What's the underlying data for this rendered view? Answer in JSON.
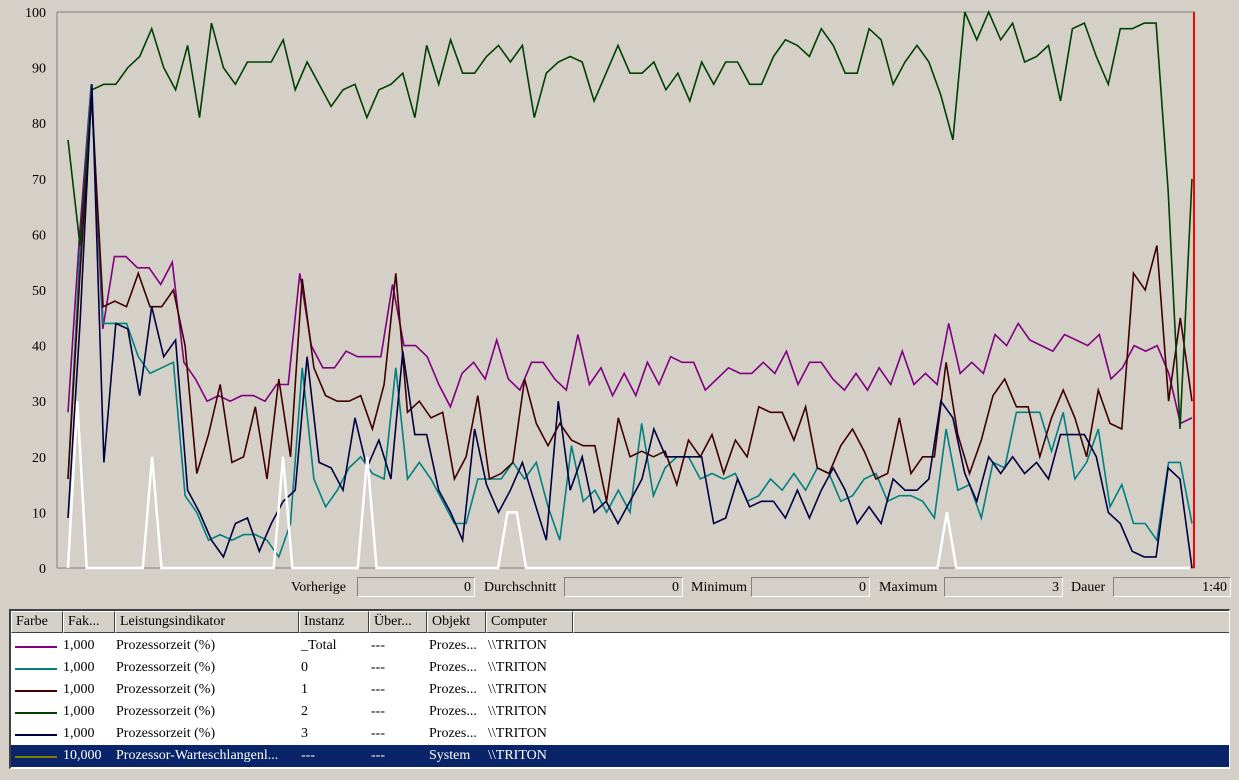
{
  "graph": {
    "ylim": [
      0,
      100
    ],
    "y_ticks": [
      "100",
      "90",
      "80",
      "70",
      "60",
      "50",
      "40",
      "30",
      "20",
      "10",
      "0"
    ],
    "cursor_color": "#ff0000",
    "background": "#d4d0c8",
    "series": [
      {
        "name": "Prozessorzeit (%) _Total",
        "color": "#800080",
        "values": [
          28,
          60,
          87,
          43,
          56,
          56,
          54,
          54,
          51,
          55,
          37,
          34,
          30,
          31,
          30,
          31,
          31,
          30,
          33,
          33,
          53,
          40,
          36,
          36,
          39,
          38,
          38,
          38,
          51,
          40,
          40,
          38,
          33,
          29,
          35,
          37,
          34,
          41,
          34,
          32,
          37,
          37,
          34,
          32,
          42,
          33,
          36,
          31,
          35,
          31,
          37,
          33,
          38,
          37,
          37,
          32,
          34,
          36,
          35,
          35,
          37,
          35,
          39,
          33,
          37,
          37,
          34,
          32,
          35,
          32,
          36,
          33,
          39,
          33,
          35,
          33,
          44,
          35,
          37,
          35,
          42,
          40,
          44,
          41,
          40,
          39,
          42,
          41,
          40,
          42,
          34,
          36,
          40,
          39,
          40,
          35,
          26,
          27
        ]
      },
      {
        "name": "Prozessorzeit (%) 0",
        "color": "#008080",
        "values": [
          16,
          56,
          87,
          44,
          44,
          44,
          38,
          35,
          36,
          37,
          13,
          10,
          5,
          6,
          5,
          6,
          6,
          5,
          2,
          8,
          36,
          16,
          11,
          14,
          18,
          20,
          17,
          16,
          36,
          16,
          19,
          16,
          12,
          8,
          8,
          16,
          16,
          16,
          19,
          16,
          19,
          11,
          5,
          22,
          12,
          14,
          10,
          14,
          10,
          26,
          13,
          18,
          20,
          20,
          16,
          17,
          16,
          17,
          12,
          13,
          16,
          14,
          17,
          14,
          18,
          17,
          12,
          13,
          16,
          17,
          12,
          13,
          13,
          12,
          9,
          25,
          14,
          15,
          9,
          19,
          18,
          28,
          28,
          28,
          21,
          28,
          16,
          19,
          25,
          11,
          15,
          8,
          8,
          5,
          19,
          19,
          8
        ]
      },
      {
        "name": "Prozessorzeit (%) 1",
        "color": "#400000",
        "values": [
          16,
          52,
          85,
          47,
          48,
          47,
          53,
          47,
          47,
          50,
          40,
          17,
          24,
          33,
          19,
          20,
          29,
          16,
          34,
          20,
          52,
          36,
          31,
          30,
          30,
          31,
          25,
          33,
          53,
          28,
          30,
          27,
          28,
          16,
          20,
          31,
          16,
          17,
          19,
          34,
          26,
          22,
          26,
          23,
          22,
          22,
          12,
          27,
          20,
          21,
          20,
          21,
          15,
          23,
          20,
          24,
          17,
          23,
          20,
          29,
          28,
          28,
          23,
          29,
          18,
          17,
          22,
          25,
          21,
          16,
          17,
          27,
          17,
          20,
          20,
          37,
          24,
          17,
          23,
          31,
          34,
          29,
          29,
          20,
          27,
          32,
          27,
          20,
          32,
          26,
          25,
          53,
          50,
          58,
          30,
          45,
          30
        ]
      },
      {
        "name": "Prozessorzeit (%) 2",
        "color": "#004000",
        "values": [
          77,
          58,
          86,
          87,
          87,
          90,
          92,
          97,
          90,
          86,
          94,
          81,
          98,
          90,
          87,
          91,
          91,
          91,
          95,
          86,
          91,
          87,
          83,
          86,
          87,
          81,
          86,
          87,
          89,
          81,
          94,
          87,
          95,
          89,
          89,
          92,
          94,
          91,
          94,
          81,
          89,
          91,
          92,
          91,
          84,
          89,
          94,
          89,
          89,
          91,
          86,
          89,
          84,
          91,
          87,
          91,
          91,
          87,
          87,
          92,
          95,
          94,
          92,
          97,
          94,
          89,
          89,
          97,
          95,
          87,
          91,
          94,
          91,
          85,
          77,
          100,
          95,
          100,
          95,
          98,
          91,
          92,
          94,
          84,
          97,
          98,
          92,
          87,
          97,
          97,
          98,
          98,
          68,
          25,
          70
        ]
      },
      {
        "name": "Prozessorzeit (%) 3",
        "color": "#000040",
        "values": [
          9,
          44,
          87,
          19,
          44,
          43,
          31,
          47,
          38,
          41,
          14,
          10,
          5,
          2,
          8,
          9,
          3,
          8,
          12,
          14,
          38,
          19,
          18,
          14,
          27,
          18,
          23,
          16,
          39,
          24,
          24,
          14,
          10,
          5,
          25,
          15,
          10,
          14,
          19,
          12,
          5,
          30,
          14,
          20,
          10,
          12,
          8,
          12,
          16,
          25,
          20,
          20,
          20,
          20,
          8,
          9,
          16,
          11,
          12,
          12,
          9,
          14,
          9,
          14,
          18,
          14,
          8,
          11,
          8,
          16,
          14,
          14,
          16,
          30,
          27,
          17,
          12,
          20,
          17,
          20,
          17,
          19,
          16,
          24,
          24,
          24,
          20,
          10,
          8,
          3,
          2,
          2,
          18,
          16,
          0
        ]
      },
      {
        "name": "Prozessor-Warteschlangenl... System",
        "color": "#ffffff",
        "values": [
          0,
          30,
          0,
          0,
          0,
          0,
          0,
          0,
          0,
          20,
          0,
          0,
          0,
          0,
          0,
          0,
          0,
          0,
          0,
          0,
          0,
          0,
          0,
          20,
          0,
          0,
          0,
          0,
          0,
          0,
          0,
          0,
          20,
          0,
          0,
          0,
          0,
          0,
          0,
          0,
          0,
          0,
          0,
          0,
          0,
          0,
          0,
          10,
          10,
          0,
          0,
          0,
          0,
          0,
          0,
          0,
          0,
          0,
          0,
          0,
          0,
          0,
          0,
          0,
          0,
          0,
          0,
          0,
          0,
          0,
          0,
          0,
          0,
          0,
          0,
          0,
          0,
          0,
          0,
          0,
          0,
          0,
          0,
          0,
          0,
          0,
          0,
          0,
          0,
          0,
          0,
          0,
          0,
          0,
          10,
          0,
          0,
          0,
          0,
          0,
          0,
          0,
          0,
          0,
          0,
          0,
          0,
          0,
          0,
          0,
          0,
          0,
          0,
          0,
          0,
          0,
          0,
          0,
          0,
          0,
          0
        ]
      }
    ]
  },
  "value_bar": {
    "last_label": "Vorherige",
    "last_value": "0",
    "average_label": "Durchschnitt",
    "average_value": "0",
    "minimum_label": "Minimum",
    "minimum_value": "0",
    "maximum_label": "Maximum",
    "maximum_value": "3",
    "duration_label": "Dauer",
    "duration_value": "1:40"
  },
  "legend": {
    "columns": [
      "Farbe",
      "Fak...",
      "Leistungsindikator",
      "Instanz",
      "Über...",
      "Objekt",
      "Computer"
    ],
    "rows": [
      {
        "color": "#800080",
        "scale": "1,000",
        "counter": "Prozessorzeit (%)",
        "instance": "_Total",
        "parent": "---",
        "object": "Prozes...",
        "computer": "\\\\TRITON",
        "selected": false
      },
      {
        "color": "#008080",
        "scale": "1,000",
        "counter": "Prozessorzeit (%)",
        "instance": "0",
        "parent": "---",
        "object": "Prozes...",
        "computer": "\\\\TRITON",
        "selected": false
      },
      {
        "color": "#400000",
        "scale": "1,000",
        "counter": "Prozessorzeit (%)",
        "instance": "1",
        "parent": "---",
        "object": "Prozes...",
        "computer": "\\\\TRITON",
        "selected": false
      },
      {
        "color": "#004000",
        "scale": "1,000",
        "counter": "Prozessorzeit (%)",
        "instance": "2",
        "parent": "---",
        "object": "Prozes...",
        "computer": "\\\\TRITON",
        "selected": false
      },
      {
        "color": "#000040",
        "scale": "1,000",
        "counter": "Prozessorzeit (%)",
        "instance": "3",
        "parent": "---",
        "object": "Prozes...",
        "computer": "\\\\TRITON",
        "selected": false
      },
      {
        "color": "#808000",
        "scale": "10,000",
        "counter": "Prozessor-Warteschlangenl...",
        "instance": "---",
        "parent": "---",
        "object": "System",
        "computer": "\\\\TRITON",
        "selected": true
      }
    ]
  }
}
